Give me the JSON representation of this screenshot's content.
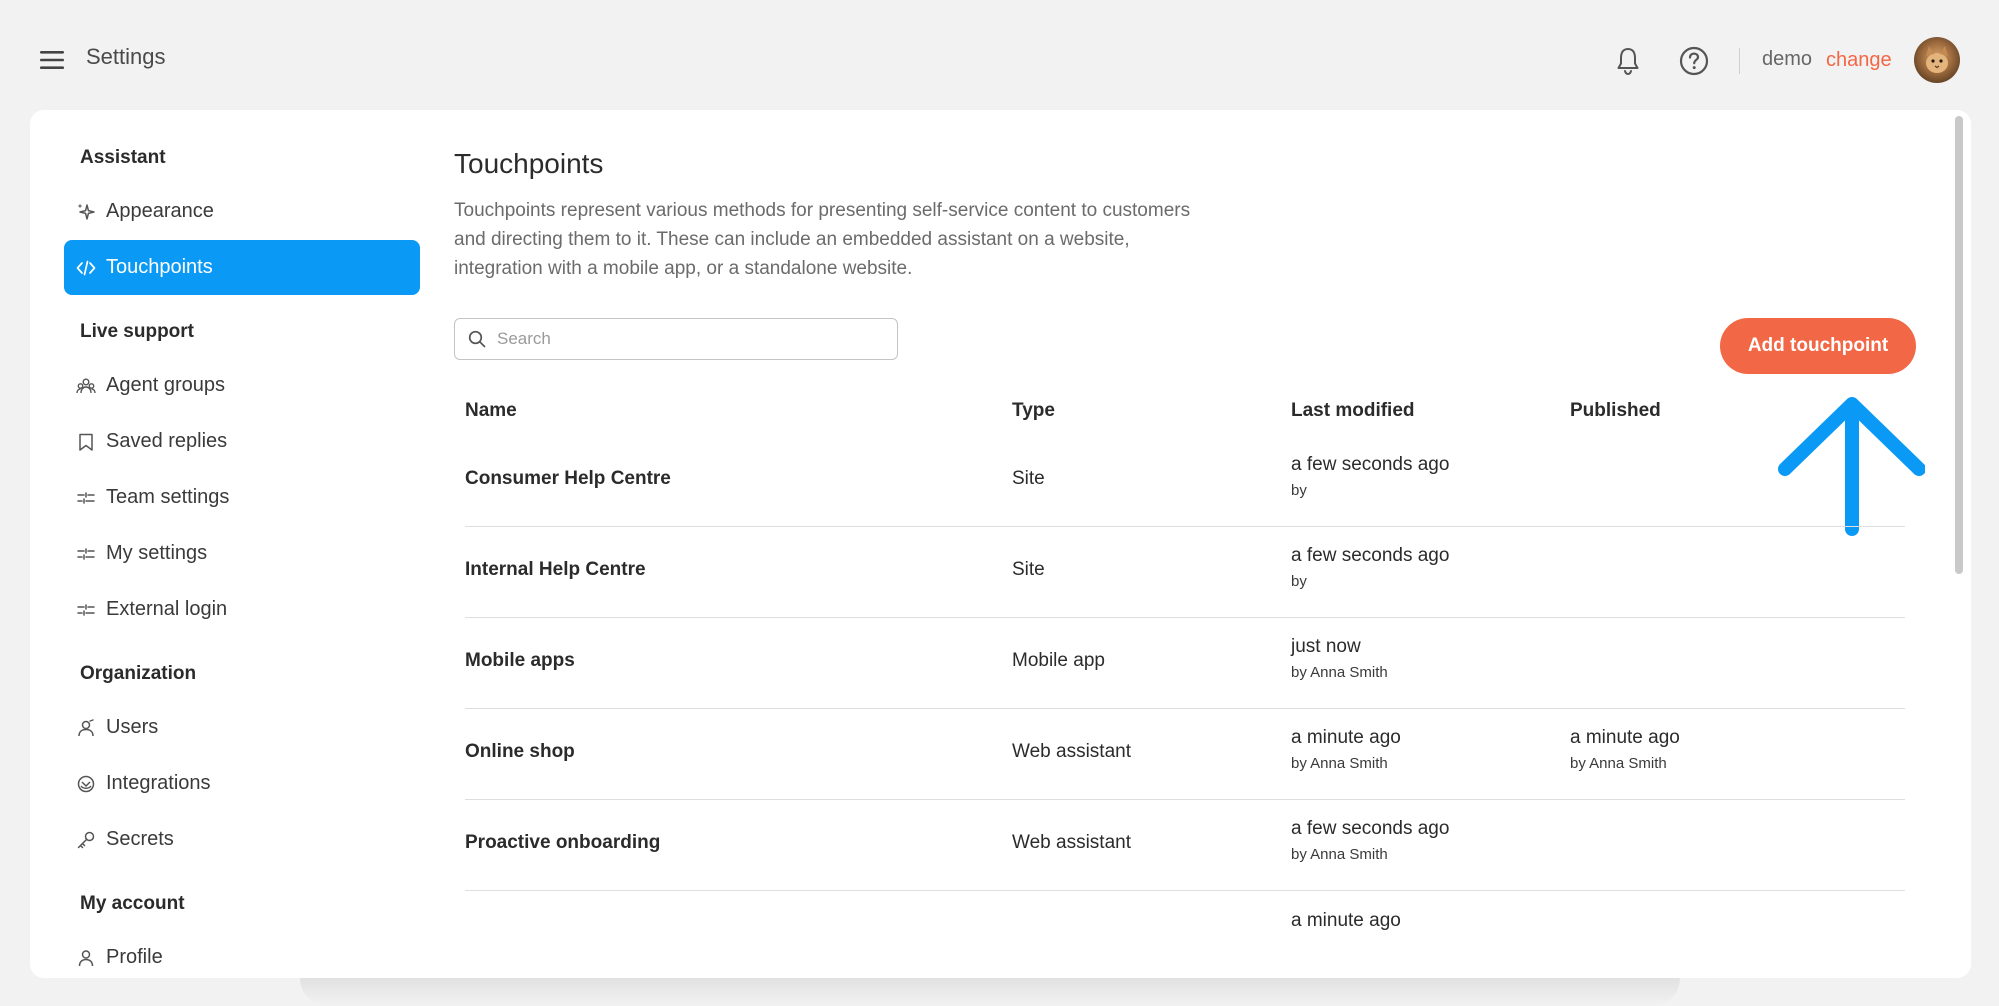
{
  "header": {
    "title": "Settings",
    "org_name": "demo",
    "org_change": "change"
  },
  "sidebar": {
    "sections": {
      "assistant": "Assistant",
      "live_support": "Live support",
      "organization": "Organization",
      "my_account": "My account"
    },
    "items": [
      {
        "label": "Appearance",
        "icon": "sparkles-icon"
      },
      {
        "label": "Touchpoints",
        "icon": "code-icon",
        "active": true
      },
      {
        "label": "Agent groups",
        "icon": "agent-groups-icon"
      },
      {
        "label": "Saved replies",
        "icon": "bookmark-icon"
      },
      {
        "label": "Team settings",
        "icon": "sliders-icon"
      },
      {
        "label": "My settings",
        "icon": "sliders-icon"
      },
      {
        "label": "External login",
        "icon": "sliders-icon"
      },
      {
        "label": "Users",
        "icon": "users-icon"
      },
      {
        "label": "Integrations",
        "icon": "integrations-icon"
      },
      {
        "label": "Secrets",
        "icon": "key-icon"
      },
      {
        "label": "Profile",
        "icon": "profile-icon"
      }
    ]
  },
  "main": {
    "title": "Touchpoints",
    "description": "Touchpoints represent various methods for presenting self-service content to customers and directing them to it. These can include an embedded assistant on a website, integration with a mobile app, or a standalone website.",
    "search_placeholder": "Search",
    "add_button": "Add touchpoint",
    "columns": [
      "Name",
      "Type",
      "Last modified",
      "Published"
    ],
    "rows": [
      {
        "name": "Consumer Help Centre",
        "type": "Site",
        "modified": "a few seconds ago",
        "modified_by": "by",
        "published": "",
        "published_by": ""
      },
      {
        "name": "Internal Help Centre",
        "type": "Site",
        "modified": "a few seconds ago",
        "modified_by": "by",
        "published": "",
        "published_by": ""
      },
      {
        "name": "Mobile apps",
        "type": "Mobile app",
        "modified": "just now",
        "modified_by": "by Anna Smith",
        "published": "",
        "published_by": ""
      },
      {
        "name": "Online shop",
        "type": "Web assistant",
        "modified": "a minute ago",
        "modified_by": "by Anna Smith",
        "published": "a minute ago",
        "published_by": "by Anna Smith"
      },
      {
        "name": "Proactive onboarding",
        "type": "Web assistant",
        "modified": "a few seconds ago",
        "modified_by": "by Anna Smith",
        "published": "",
        "published_by": ""
      }
    ],
    "partial_row_modified": "a minute ago"
  },
  "colors": {
    "accent_blue": "#0a99f5",
    "accent_orange": "#f26745",
    "background": "#f2f2f2"
  }
}
